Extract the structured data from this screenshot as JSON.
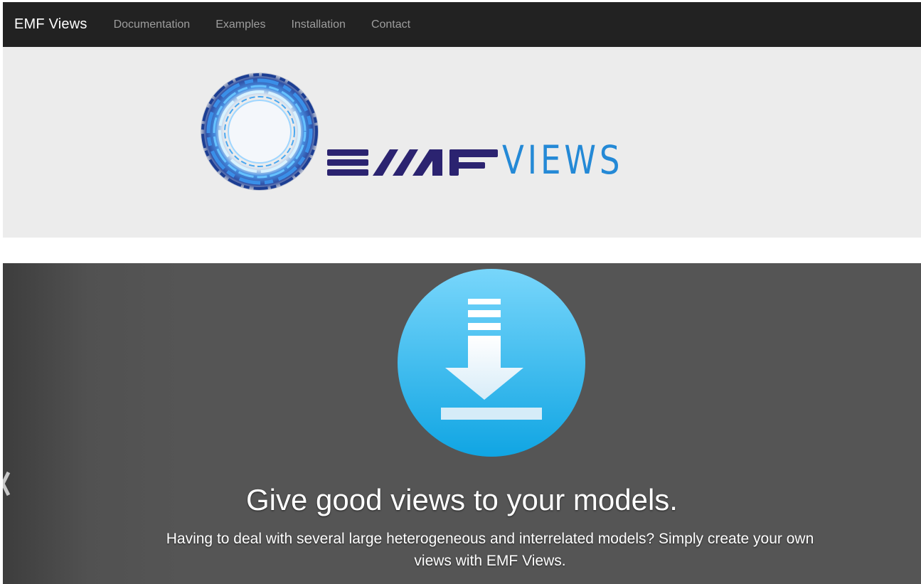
{
  "navbar": {
    "brand": "EMF Views",
    "links": [
      "Documentation",
      "Examples",
      "Installation",
      "Contact"
    ]
  },
  "banner": {
    "logo_text_emf": "EMF",
    "logo_text_views": "VIEWS",
    "icons": [
      "ring-logo-icon"
    ]
  },
  "carousel": {
    "icon": "download-icon",
    "title": "Give good views to your models.",
    "text": "Having to deal with several large heterogeneous and interrelated models? Simply create your own views with EMF Views.",
    "prev_icon": "chevron-left-icon"
  },
  "colors": {
    "navbar_bg": "#222222",
    "nav_link": "#9d9d9d",
    "banner_bg": "#ececec",
    "logo_dark": "#2b2370",
    "logo_blue": "#2489d6",
    "carousel_bg": "#555555",
    "download_circle": "#3ab7ec"
  }
}
